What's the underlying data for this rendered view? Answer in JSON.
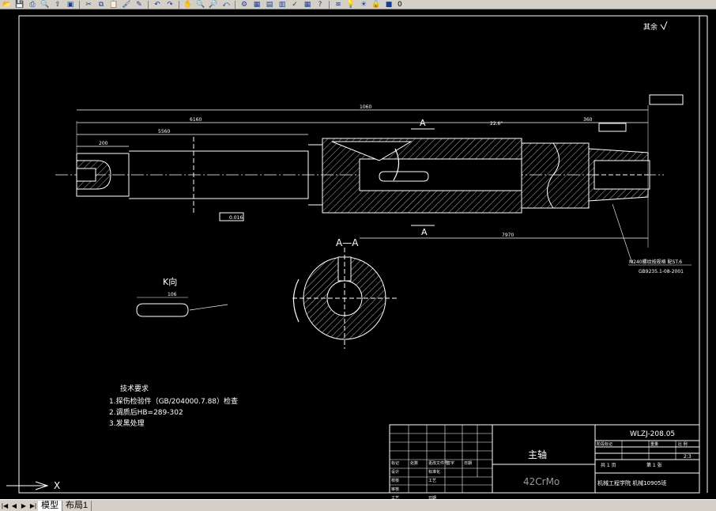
{
  "toolbar": {
    "buttons": [
      {
        "name": "open-icon",
        "glyph": "📂"
      },
      {
        "name": "save-icon",
        "glyph": "💾"
      },
      {
        "name": "print-icon",
        "glyph": "⎙"
      },
      {
        "name": "preview-icon",
        "glyph": "🔍"
      },
      {
        "name": "publish-icon",
        "glyph": "⇪"
      },
      {
        "name": "plot-icon",
        "glyph": "▣"
      },
      {
        "name": "cut-icon",
        "glyph": "✂"
      },
      {
        "name": "copy-icon",
        "glyph": "⧉"
      },
      {
        "name": "paste-icon",
        "glyph": "📋"
      },
      {
        "name": "match-properties-icon",
        "glyph": "🖌"
      },
      {
        "name": "block-editor-icon",
        "glyph": "✎"
      },
      {
        "name": "undo-icon",
        "glyph": "↶"
      },
      {
        "name": "redo-icon",
        "glyph": "↷"
      },
      {
        "name": "pan-icon",
        "glyph": "✋"
      },
      {
        "name": "zoom-realtime-icon",
        "glyph": "🔍"
      },
      {
        "name": "zoom-window-icon",
        "glyph": "🔎"
      },
      {
        "name": "zoom-previous-icon",
        "glyph": "⤺"
      },
      {
        "name": "properties-icon",
        "glyph": "⚙"
      },
      {
        "name": "design-center-icon",
        "glyph": "▦"
      },
      {
        "name": "tool-palettes-icon",
        "glyph": "▤"
      },
      {
        "name": "sheet-set-icon",
        "glyph": "▥"
      },
      {
        "name": "markup-icon",
        "glyph": "✓"
      },
      {
        "name": "calculator-icon",
        "glyph": "▦"
      },
      {
        "name": "help-icon",
        "glyph": "?"
      },
      {
        "name": "layer-properties-icon",
        "glyph": "≋"
      },
      {
        "name": "layer-bulb-icon",
        "glyph": "💡"
      },
      {
        "name": "layer-sun-icon",
        "glyph": "☀"
      },
      {
        "name": "layer-lock-icon",
        "glyph": "🔓"
      },
      {
        "name": "layer-color-icon",
        "glyph": "■"
      }
    ],
    "layer_name": "0"
  },
  "drawing": {
    "roughness_note": "其余",
    "section_label": "A—A",
    "view_k": "K向",
    "arrow_a": "A",
    "tech_title": "技术要求",
    "tech_items": [
      "1.探伤检验件（GB/204000.7.88）检查",
      "2.调质后HB=289-302",
      "3.发黑处理"
    ],
    "thread_note": "M240螺纹按规格 配ST.6",
    "thread_std": "GB9235.1-08-2001",
    "dims": {
      "overall": "1060",
      "left_len": "6160",
      "left_inner": "5560",
      "small": "200",
      "right": "360",
      "bottom": "7970",
      "taper": "22.6°",
      "k_len": "106",
      "gauge": "0.016"
    }
  },
  "title_block": {
    "part_name": "主轴",
    "material": "42CrMo",
    "drawing_no": "WLZJ-208.05",
    "org": "机械工程学院  机械10905班",
    "headers": [
      "阶段标记",
      "重量",
      "比 例"
    ],
    "scale": "2:3",
    "sheet_total": "共 1 页",
    "sheet_no": "第 1 张",
    "rows": [
      [
        "标记",
        "处数",
        "更改文件号",
        "签字",
        "日期"
      ],
      [
        "设计",
        "",
        "标准化",
        "",
        ""
      ],
      [
        "校核",
        "",
        "工艺",
        "",
        ""
      ],
      [
        "审核",
        "",
        "",
        ""
      ],
      [
        "工艺",
        "",
        "日期",
        ""
      ]
    ]
  },
  "statusbar": {
    "tabs": [
      "模型",
      "布局1"
    ]
  },
  "ucs": {
    "x_label": "X"
  }
}
